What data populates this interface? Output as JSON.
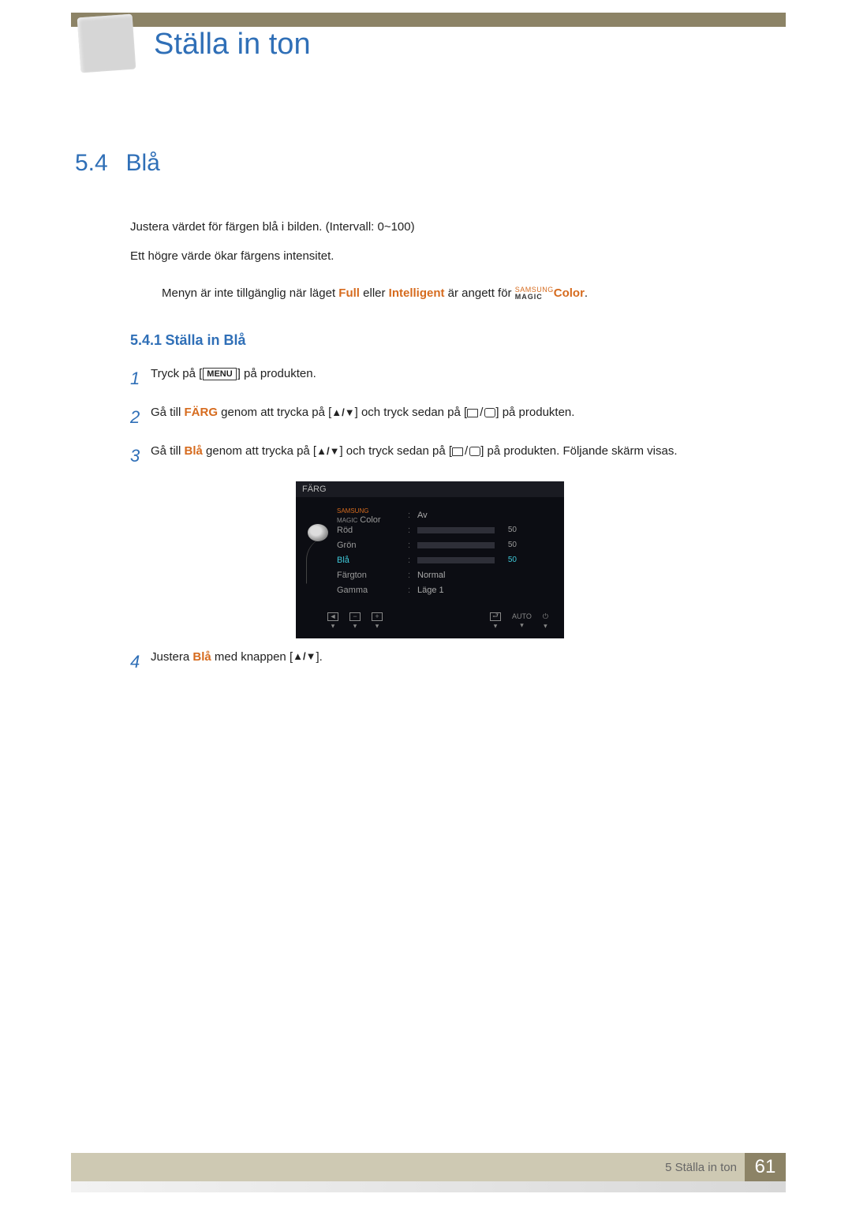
{
  "chapter_number": "5",
  "chapter_title": "Ställa in ton",
  "section": {
    "number": "5.4",
    "title": "Blå"
  },
  "intro": {
    "line1": "Justera värdet för färgen blå i bilden. (Intervall: 0~100)",
    "line2": "Ett högre värde ökar färgens intensitet."
  },
  "note": {
    "prefix": "Menyn är inte tillgänglig när läget ",
    "full": "Full",
    "mid": " eller ",
    "intelligent": "Intelligent",
    "suffix1": " är angett för ",
    "magic_small": "SAMSUNG",
    "magic_big": "MAGIC",
    "color": "Color",
    "suffix2": "."
  },
  "subsection": {
    "number": "5.4.1",
    "title": "Ställa in Blå"
  },
  "steps": [
    {
      "num": "1",
      "text": {
        "a": "Tryck på [",
        "menu": "MENU",
        "b": "] på produkten."
      }
    },
    {
      "num": "2",
      "text": {
        "a": "Gå till ",
        "bold": "FÄRG",
        "b": " genom att trycka på [",
        "c": "] och tryck sedan på [",
        "d": "] på produkten."
      }
    },
    {
      "num": "3",
      "text": {
        "a": "Gå till ",
        "bold": "Blå",
        "b": " genom att trycka på [",
        "c": "] och tryck sedan på [",
        "d": "] på produkten. Följande skärm visas."
      }
    },
    {
      "num": "4",
      "text": {
        "a": "Justera ",
        "bold": "Blå",
        "b": " med knappen [",
        "c": "]."
      }
    }
  ],
  "osd": {
    "title": "FÄRG",
    "magic_label_small": "SAMSUNG",
    "magic_label_big": "MAGIC",
    "color_suffix": "Color",
    "rows": [
      {
        "label": "",
        "type": "magic",
        "value": "Av"
      },
      {
        "label": "Röd",
        "type": "slider",
        "fill": 50,
        "value": "50"
      },
      {
        "label": "Grön",
        "type": "slider",
        "fill": 50,
        "value": "50"
      },
      {
        "label": "Blå",
        "type": "slider",
        "fill": 50,
        "value": "50",
        "active": true
      },
      {
        "label": "Färgton",
        "type": "text",
        "value": "Normal"
      },
      {
        "label": "Gamma",
        "type": "text",
        "value": "Läge 1"
      }
    ],
    "bottom": {
      "back": "◄",
      "minus": "−",
      "plus": "+",
      "enter_icon": "⏎",
      "auto": "AUTO",
      "power": "⏻",
      "down": "▾"
    }
  },
  "footer": {
    "chapter_ref": "5 Ställa in ton",
    "page": "61"
  }
}
